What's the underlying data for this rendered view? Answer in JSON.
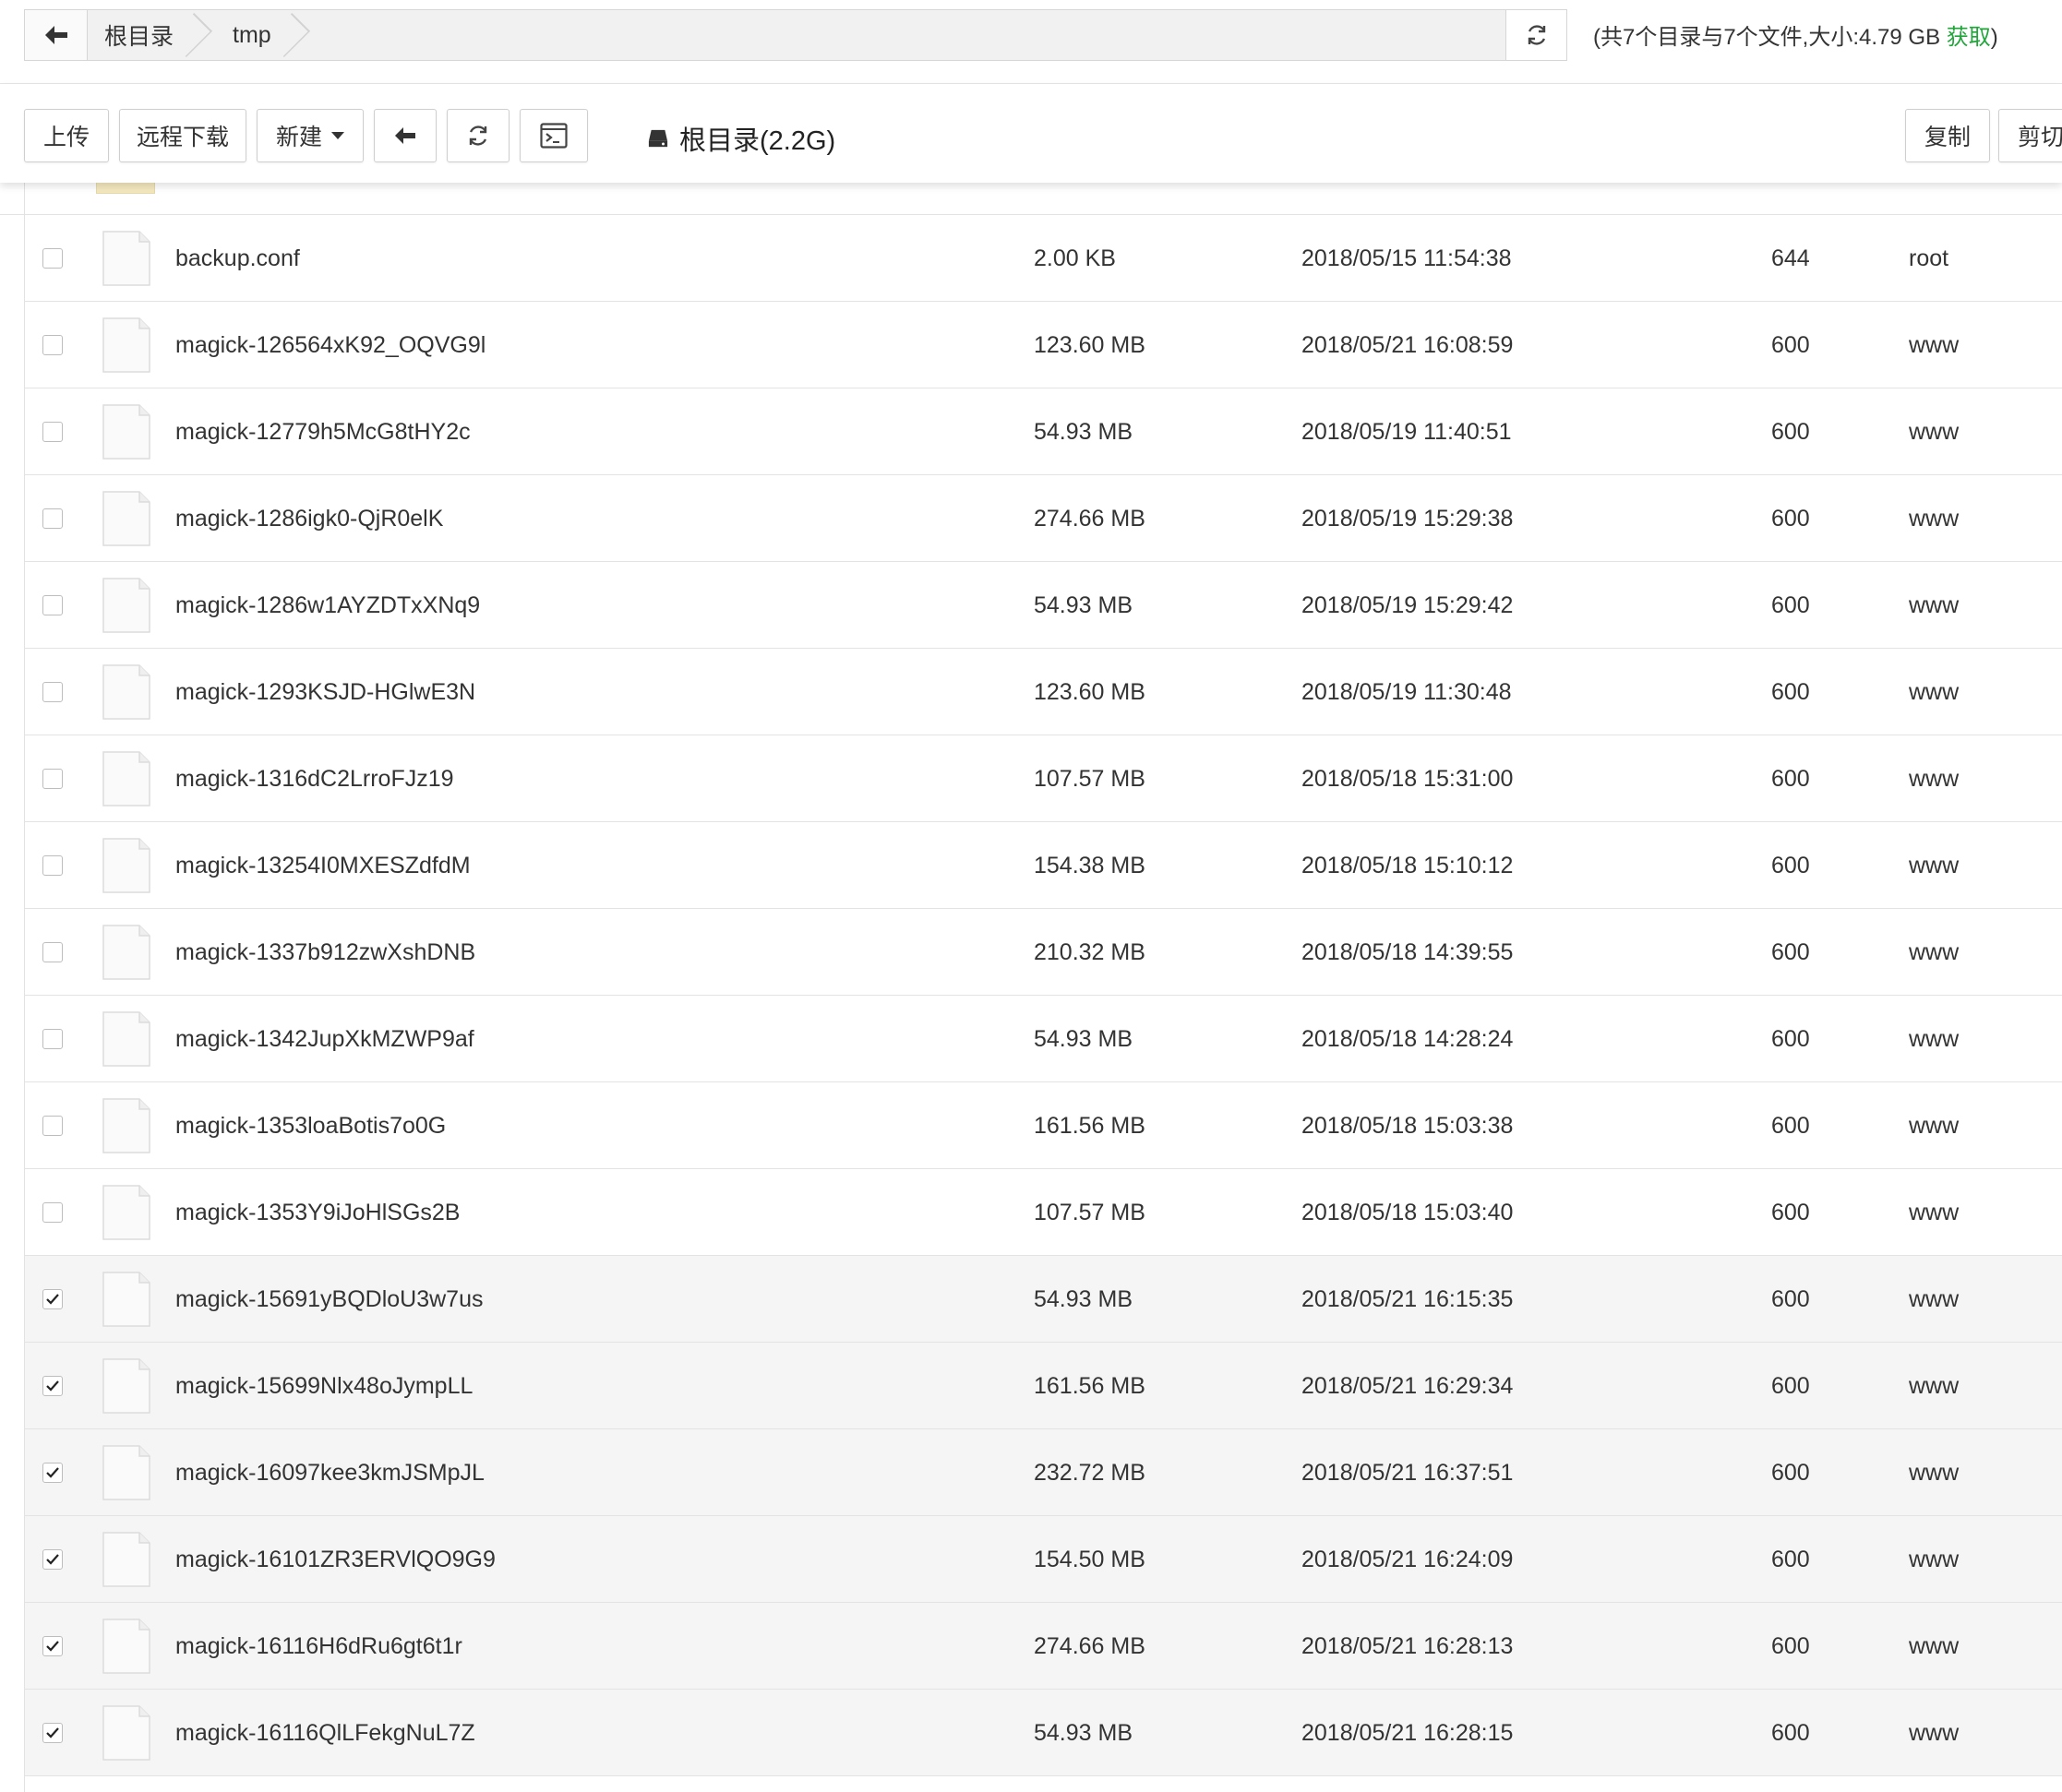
{
  "pathbar": {
    "crumbs": [
      "根目录",
      "tmp"
    ],
    "summary_prefix": "(共7个目录与7个文件,大小:4.79 GB ",
    "summary_link": "获取",
    "summary_suffix": ")"
  },
  "toolbar": {
    "upload": "上传",
    "remote_download": "远程下载",
    "new": "新建",
    "disk": "根目录(2.2G)",
    "copy": "复制",
    "cut": "剪切"
  },
  "files": [
    {
      "name": "backup.conf",
      "size": "2.00 KB",
      "time": "2018/05/15 11:54:38",
      "perm": "644",
      "owner": "root",
      "checked": false
    },
    {
      "name": "magick-126564xK92_OQVG9l",
      "size": "123.60 MB",
      "time": "2018/05/21 16:08:59",
      "perm": "600",
      "owner": "www",
      "checked": false
    },
    {
      "name": "magick-12779h5McG8tHY2c",
      "size": "54.93 MB",
      "time": "2018/05/19 11:40:51",
      "perm": "600",
      "owner": "www",
      "checked": false
    },
    {
      "name": "magick-1286igk0-QjR0elK",
      "size": "274.66 MB",
      "time": "2018/05/19 15:29:38",
      "perm": "600",
      "owner": "www",
      "checked": false
    },
    {
      "name": "magick-1286w1AYZDTxXNq9",
      "size": "54.93 MB",
      "time": "2018/05/19 15:29:42",
      "perm": "600",
      "owner": "www",
      "checked": false
    },
    {
      "name": "magick-1293KSJD-HGlwE3N",
      "size": "123.60 MB",
      "time": "2018/05/19 11:30:48",
      "perm": "600",
      "owner": "www",
      "checked": false
    },
    {
      "name": "magick-1316dC2LrroFJz19",
      "size": "107.57 MB",
      "time": "2018/05/18 15:31:00",
      "perm": "600",
      "owner": "www",
      "checked": false
    },
    {
      "name": "magick-13254I0MXESZdfdM",
      "size": "154.38 MB",
      "time": "2018/05/18 15:10:12",
      "perm": "600",
      "owner": "www",
      "checked": false
    },
    {
      "name": "magick-1337b912zwXshDNB",
      "size": "210.32 MB",
      "time": "2018/05/18 14:39:55",
      "perm": "600",
      "owner": "www",
      "checked": false
    },
    {
      "name": "magick-1342JupXkMZWP9af",
      "size": "54.93 MB",
      "time": "2018/05/18 14:28:24",
      "perm": "600",
      "owner": "www",
      "checked": false
    },
    {
      "name": "magick-1353loaBotis7o0G",
      "size": "161.56 MB",
      "time": "2018/05/18 15:03:38",
      "perm": "600",
      "owner": "www",
      "checked": false
    },
    {
      "name": "magick-1353Y9iJoHlSGs2B",
      "size": "107.57 MB",
      "time": "2018/05/18 15:03:40",
      "perm": "600",
      "owner": "www",
      "checked": false
    },
    {
      "name": "magick-15691yBQDloU3w7us",
      "size": "54.93 MB",
      "time": "2018/05/21 16:15:35",
      "perm": "600",
      "owner": "www",
      "checked": true
    },
    {
      "name": "magick-15699Nlx48oJympLL",
      "size": "161.56 MB",
      "time": "2018/05/21 16:29:34",
      "perm": "600",
      "owner": "www",
      "checked": true
    },
    {
      "name": "magick-16097kee3kmJSMpJL",
      "size": "232.72 MB",
      "time": "2018/05/21 16:37:51",
      "perm": "600",
      "owner": "www",
      "checked": true
    },
    {
      "name": "magick-16101ZR3ERVlQO9G9",
      "size": "154.50 MB",
      "time": "2018/05/21 16:24:09",
      "perm": "600",
      "owner": "www",
      "checked": true
    },
    {
      "name": "magick-16116H6dRu6gt6t1r",
      "size": "274.66 MB",
      "time": "2018/05/21 16:28:13",
      "perm": "600",
      "owner": "www",
      "checked": true
    },
    {
      "name": "magick-16116QlLFekgNuL7Z",
      "size": "54.93 MB",
      "time": "2018/05/21 16:28:15",
      "perm": "600",
      "owner": "www",
      "checked": true
    }
  ]
}
